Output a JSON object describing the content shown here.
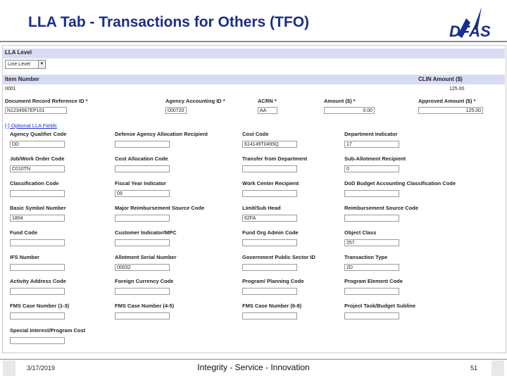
{
  "slide": {
    "title": "LLA Tab - Transactions for Others (TFO)"
  },
  "lla_level": {
    "label": "LLA Level",
    "value": "Line Level"
  },
  "item": {
    "col1": "Item Number",
    "col2": "CLIN Amount ($)",
    "number": "0001",
    "clin_amount": "125.00"
  },
  "doc": {
    "labels": [
      "Document Record Reference ID *",
      "Agency Accounting ID *",
      "ACRN *",
      "Amount ($) *",
      "Approved Amount ($) *"
    ],
    "values": [
      "N1234567EP101",
      "000720",
      "AA",
      "0.00",
      "125.00"
    ]
  },
  "optional_link": "[-] Optional LLA Fields",
  "fields": [
    {
      "label": "Agency Qualifier Code",
      "value": "DD"
    },
    {
      "label": "Defense Agency Allocation Recipient",
      "value": ""
    },
    {
      "label": "Cost Code",
      "value": "614149T0495Q"
    },
    {
      "label": "Department Indicator",
      "value": "17"
    },
    {
      "label": "Job/Work Order Code",
      "value": "C010TN"
    },
    {
      "label": "Cost Allocation Code",
      "value": ""
    },
    {
      "label": "Transfer from Department",
      "value": ""
    },
    {
      "label": "Sub-Allotment Recipient",
      "value": "0"
    },
    {
      "label": "Classification Code",
      "value": ""
    },
    {
      "label": "Fiscal Year Indicator",
      "value": "09"
    },
    {
      "label": "Work Center Recipient",
      "value": ""
    },
    {
      "label": "DoD Budget Accounting Classification Code",
      "value": ""
    },
    {
      "label": "Basic Symbol Number",
      "value": "1804"
    },
    {
      "label": "Major Reimbursement Source Code",
      "value": ""
    },
    {
      "label": "Limit/Sub Head",
      "value": "62FA"
    },
    {
      "label": "Reimbursement Source Code",
      "value": ""
    },
    {
      "label": "Fund Code",
      "value": ""
    },
    {
      "label": "Customer Indicator/MPC",
      "value": ""
    },
    {
      "label": "Fund Org Admin Code",
      "value": ""
    },
    {
      "label": "Object Class",
      "value": "257"
    },
    {
      "label": "IFS Number",
      "value": ""
    },
    {
      "label": "Allotment Serial Number",
      "value": "00032"
    },
    {
      "label": "Government Public Sector ID",
      "value": ""
    },
    {
      "label": "Transaction Type",
      "value": "2D"
    },
    {
      "label": "Activity Address Code",
      "value": ""
    },
    {
      "label": "Foreign Currency Code",
      "value": ""
    },
    {
      "label": "Program/ Planning Code",
      "value": ""
    },
    {
      "label": "Program Element Code",
      "value": ""
    },
    {
      "label": "FMS Case Number (1-3)",
      "value": ""
    },
    {
      "label": "FMS Case Number (4-5)",
      "value": ""
    },
    {
      "label": "FMS Case Number (6-8)",
      "value": ""
    },
    {
      "label": "Project Task/Budget Subline",
      "value": ""
    },
    {
      "label": "Special Interest/Program Cost",
      "value": ""
    }
  ],
  "footer": {
    "date": "3/17/2019",
    "tagline": "Integrity - Service - Innovation",
    "page": "51"
  },
  "colors": {
    "title": "#1a2e8a",
    "header_bar": "#d8dcf3",
    "link": "#1a2ed8"
  }
}
